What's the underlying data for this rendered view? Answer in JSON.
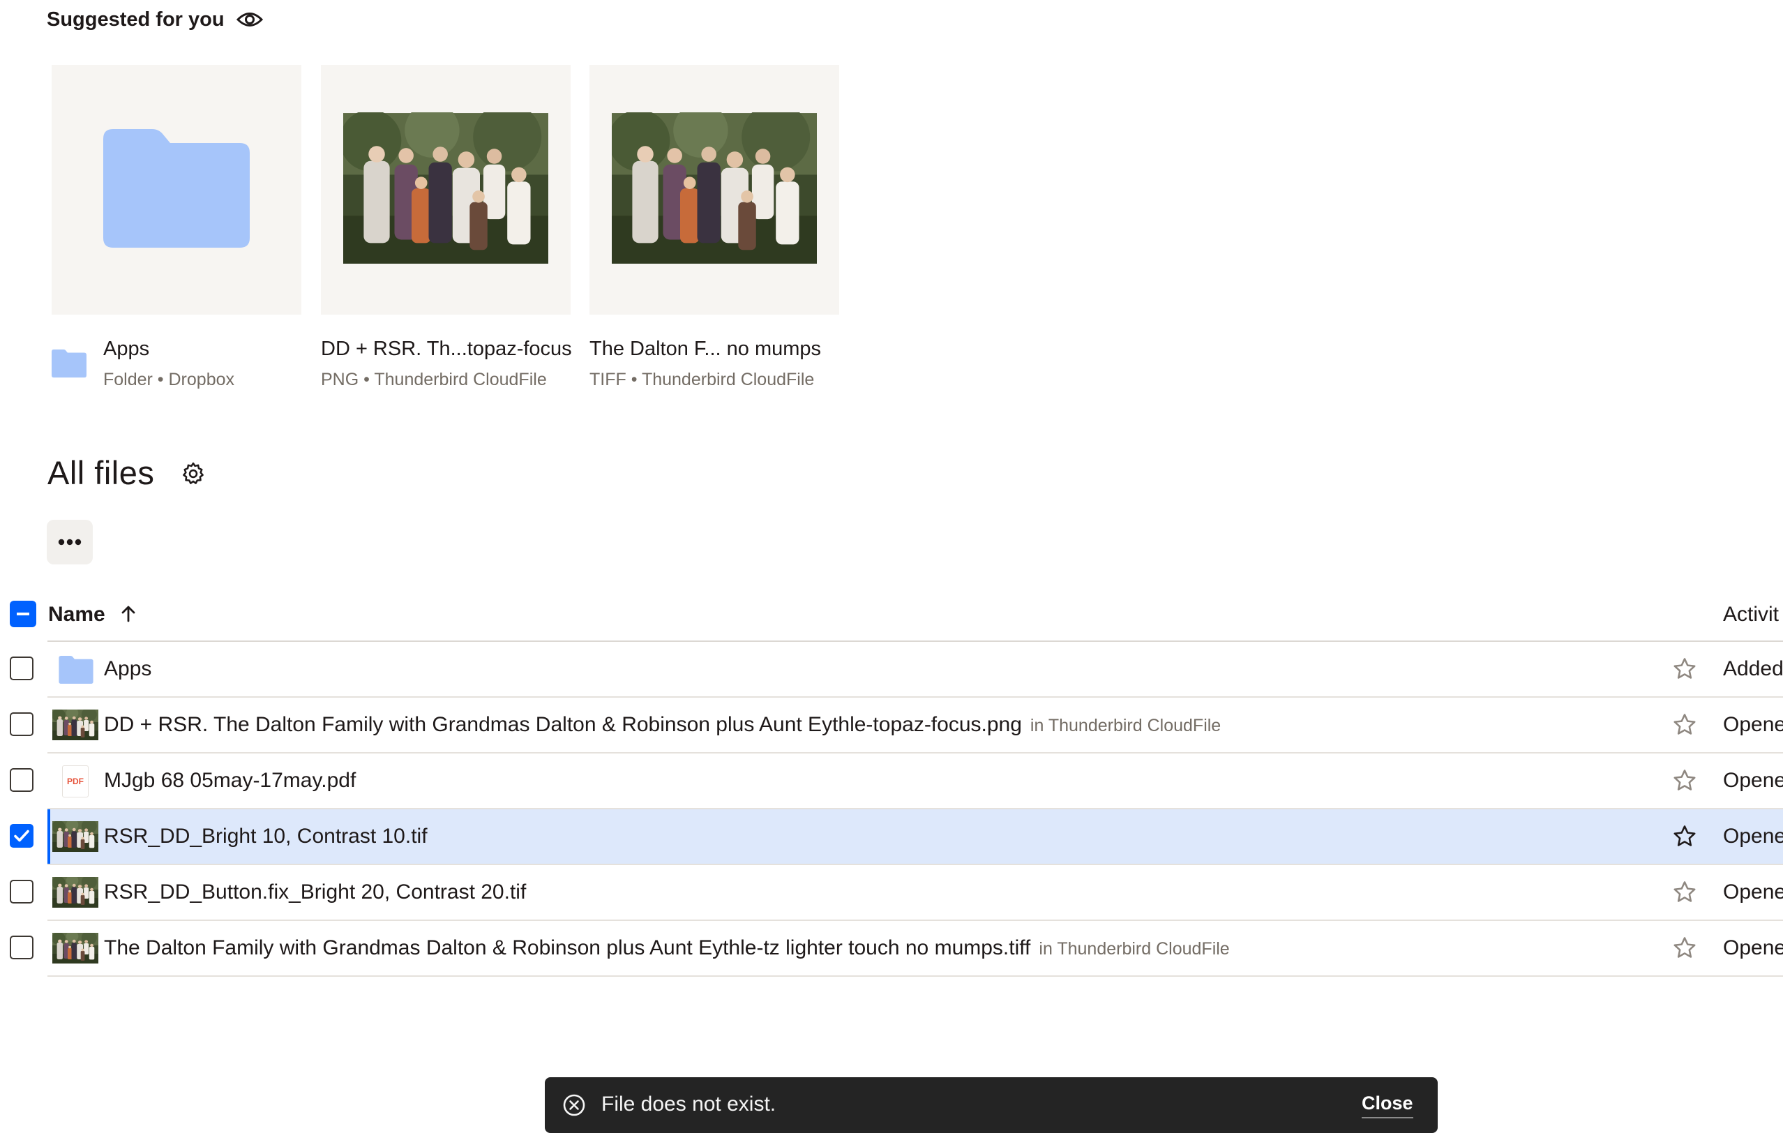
{
  "suggested": {
    "title": "Suggested for you",
    "items": [
      {
        "name": "Apps",
        "meta": "Folder • Dropbox",
        "icon": "folder-icon"
      },
      {
        "name": "DD + RSR. Th...topaz-focus",
        "meta": "PNG • Thunderbird CloudFile",
        "icon": "photo-thumbnail"
      },
      {
        "name": "The Dalton F... no mumps",
        "meta": "TIFF • Thunderbird CloudFile",
        "icon": "photo-thumbnail"
      }
    ]
  },
  "all_files": {
    "title": "All files",
    "more_button_label": "•••",
    "header": {
      "name": "Name",
      "activity": "Activit"
    },
    "rows": [
      {
        "name": "Apps",
        "location": "",
        "activity": "Added",
        "selected": false,
        "icon": "folder-icon"
      },
      {
        "name": "DD + RSR. The Dalton Family with Grandmas Dalton & Robinson plus Aunt Eythle-topaz-focus.png",
        "location": "in Thunderbird CloudFile",
        "activity": "Opene",
        "selected": false,
        "icon": "photo-thumbnail"
      },
      {
        "name": "MJgb 68 05may-17may.pdf",
        "location": "",
        "activity": "Opene",
        "selected": false,
        "icon": "pdf-icon",
        "icon_text": "PDF"
      },
      {
        "name": "RSR_DD_Bright 10, Contrast 10.tif",
        "location": "",
        "activity": "Opene",
        "selected": true,
        "icon": "photo-thumbnail"
      },
      {
        "name": "RSR_DD_Button.fix_Bright 20, Contrast 20.tif",
        "location": "",
        "activity": "Opene",
        "selected": false,
        "icon": "photo-thumbnail"
      },
      {
        "name": "The Dalton Family with Grandmas Dalton & Robinson plus Aunt Eythle-tz lighter touch no mumps.tiff",
        "location": "in Thunderbird CloudFile",
        "activity": "Opene",
        "selected": false,
        "icon": "photo-thumbnail"
      }
    ]
  },
  "toast": {
    "message": "File does not exist.",
    "close_label": "Close"
  },
  "colors": {
    "accent": "#0061fe",
    "selected_row": "#dde8fb",
    "folder": "#a6c5fa",
    "toast_bg": "#242424",
    "tile_bg": "#f7f5f2"
  }
}
